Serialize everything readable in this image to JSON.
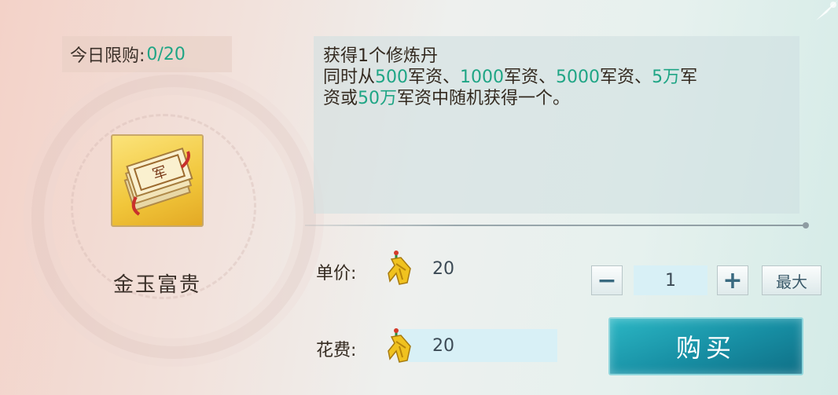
{
  "limit": {
    "label": "今日限购:",
    "value": "0/20"
  },
  "item": {
    "name": "金玉富贵",
    "icon": "item-scroll-icon"
  },
  "description": {
    "line1": "获得1个修炼丹",
    "line2": [
      {
        "t": "同时从",
        "hl": false
      },
      {
        "t": "500",
        "hl": true
      },
      {
        "t": "军资、",
        "hl": false
      },
      {
        "t": "1000",
        "hl": true
      },
      {
        "t": "军资、",
        "hl": false
      },
      {
        "t": "5000",
        "hl": true
      },
      {
        "t": "军资、",
        "hl": false
      },
      {
        "t": "5万",
        "hl": true
      },
      {
        "t": "军",
        "hl": false
      }
    ],
    "line3": [
      {
        "t": "资或",
        "hl": false
      },
      {
        "t": "50万",
        "hl": true
      },
      {
        "t": "军资中随机获得一个。",
        "hl": false
      }
    ]
  },
  "unit_price": {
    "label": "单价:",
    "value": "20",
    "currency_icon": "gold-token-icon"
  },
  "quantity": {
    "minus": "−",
    "value": "1",
    "plus": "+",
    "max_label": "最大"
  },
  "cost": {
    "label": "花费:",
    "value": "20",
    "currency_icon": "gold-token-icon"
  },
  "buy_button": {
    "label": "购买"
  },
  "colors": {
    "highlight": "#1fa585",
    "buy_button": "#178ea3",
    "field_bg": "#d8f0f6"
  }
}
